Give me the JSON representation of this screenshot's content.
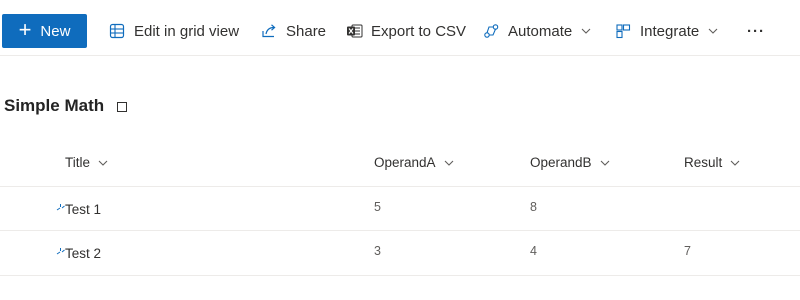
{
  "toolbar": {
    "new_label": "New",
    "edit_grid_label": "Edit in grid view",
    "share_label": "Share",
    "export_label": "Export to CSV",
    "automate_label": "Automate",
    "integrate_label": "Integrate",
    "more_label": "···"
  },
  "list": {
    "title": "Simple Math",
    "columns": {
      "title": "Title",
      "operand_a": "OperandA",
      "operand_b": "OperandB",
      "result": "Result"
    },
    "rows": [
      {
        "title": "Test 1",
        "operand_a": "5",
        "operand_b": "8",
        "result": ""
      },
      {
        "title": "Test 2",
        "operand_a": "3",
        "operand_b": "4",
        "result": "7"
      }
    ]
  },
  "colors": {
    "accent": "#0f6cbd",
    "text": "#323130",
    "divider": "#edebe9"
  },
  "icons": {
    "edit_grid": "grid-icon",
    "share": "share-icon",
    "export": "excel-icon",
    "automate": "flow-icon",
    "integrate": "integrate-icon",
    "new_item": "new-item-sparkle-icon"
  }
}
